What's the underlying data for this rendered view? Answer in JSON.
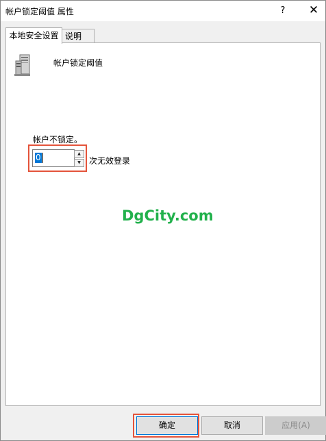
{
  "window": {
    "title": "帐户锁定阈值 属性",
    "help_label": "?",
    "close_label": "✕"
  },
  "tabs": [
    {
      "label": "本地安全设置",
      "active": true
    },
    {
      "label": "说明",
      "active": false
    }
  ],
  "policy": {
    "title": "帐户锁定阈值",
    "icon": "server-computer-icon"
  },
  "status_text": "帐户不锁定。",
  "threshold": {
    "value": "0",
    "unit_label": "次无效登录"
  },
  "watermark": "DgCity.com",
  "buttons": {
    "ok": "确定",
    "cancel": "取消",
    "apply": "应用(A)"
  },
  "colors": {
    "highlight": "#e4533a",
    "watermark": "#22b14c",
    "selection": "#0078d7"
  }
}
